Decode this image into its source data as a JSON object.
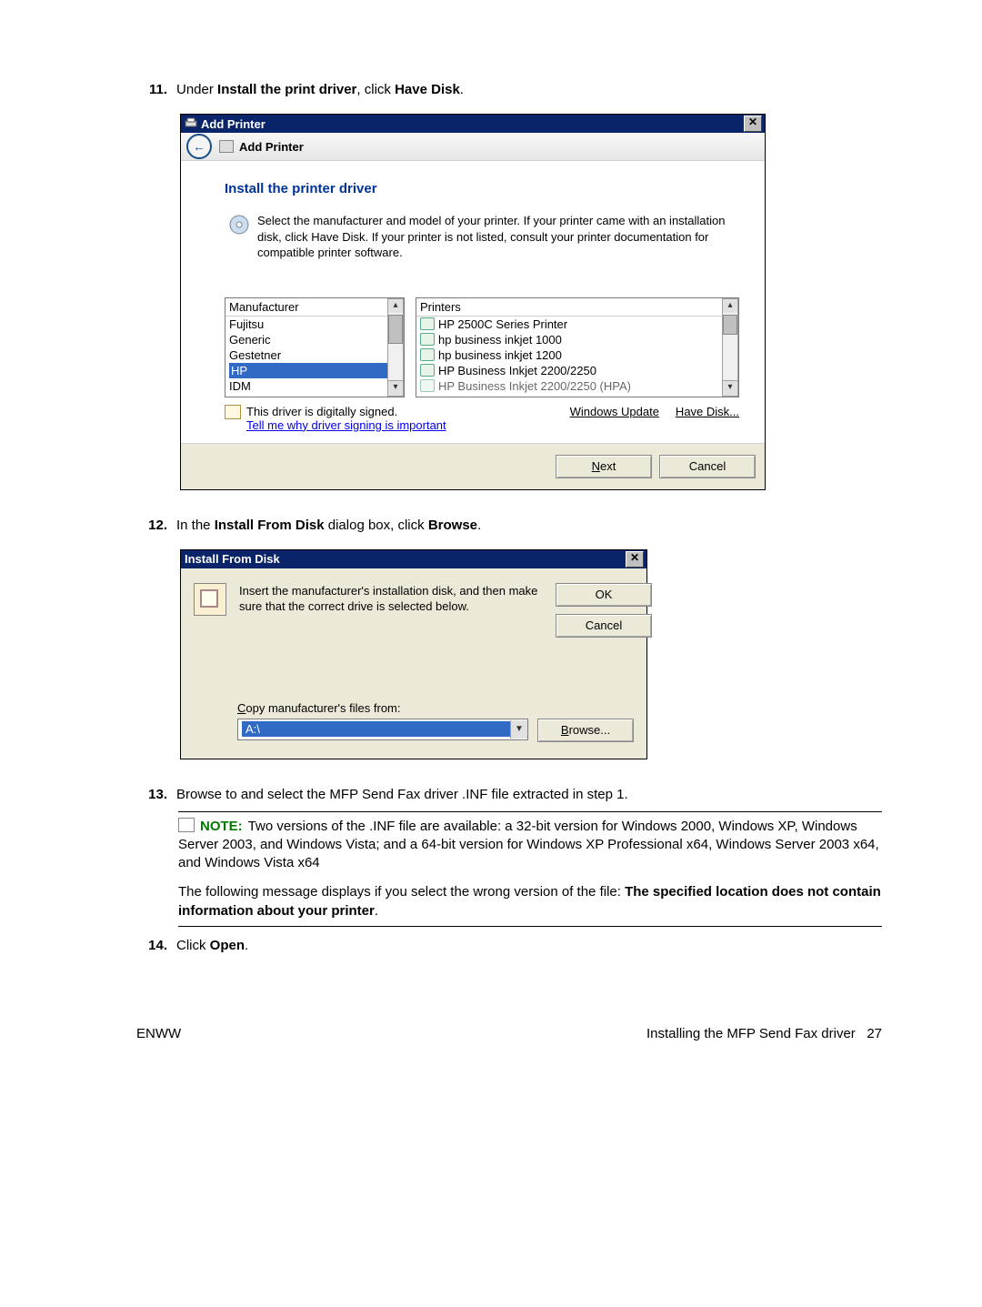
{
  "step11": {
    "num": "11.",
    "pre": "Under ",
    "b1": "Install the print driver",
    "mid": ", click ",
    "b2": "Have Disk",
    "post": "."
  },
  "addPrinter": {
    "title": "Add Printer",
    "nav": "Add Printer",
    "heading": "Install the printer driver",
    "instruction": "Select the manufacturer and model of your printer. If your printer came with an installation disk, click Have Disk. If your printer is not listed, consult your printer documentation for compatible printer software.",
    "manuHeader": "Manufacturer",
    "manufacturers": [
      "Fujitsu",
      "Generic",
      "Gestetner",
      "HP",
      "IDM"
    ],
    "selectedManuIndex": 3,
    "printerHeader": "Printers",
    "printers": [
      "HP 2500C Series Printer",
      "hp business inkjet 1000",
      "hp business inkjet 1200",
      "HP Business Inkjet 2200/2250",
      "HP Business Inkjet 2200/2250 (HPA)"
    ],
    "signed": "This driver is digitally signed.",
    "tellMe": "Tell me why driver signing is important",
    "winUpdate": "Windows Update",
    "haveDisk": "Have Disk...",
    "next": "Next",
    "cancel": "Cancel"
  },
  "step12": {
    "num": "12.",
    "pre": "In the ",
    "b1": "Install From Disk",
    "mid": " dialog box, click ",
    "b2": "Browse",
    "post": "."
  },
  "ifd": {
    "title": "Install From Disk",
    "text": "Insert the manufacturer's installation disk, and then make sure that the correct drive is selected below.",
    "ok": "OK",
    "cancel": "Cancel",
    "copyLabel": "Copy manufacturer's files from:",
    "path": "A:\\",
    "browse": "Browse..."
  },
  "step13": {
    "num": "13.",
    "text": "Browse to and select the MFP Send Fax driver .INF file extracted in step 1."
  },
  "note": {
    "label": "NOTE:",
    "body1": "Two versions of the .INF file are available: a 32-bit version for Windows 2000, Windows XP, Windows Server 2003, and Windows Vista; and a 64-bit version for Windows XP Professional x64, Windows Server 2003 x64, and Windows Vista x64",
    "body2a": "The following message displays if you select the wrong version of the file: ",
    "body2b": "The specified location does not contain information about your printer",
    "body2c": "."
  },
  "step14": {
    "num": "14.",
    "pre": "Click ",
    "b1": "Open",
    "post": "."
  },
  "footer": {
    "left": "ENWW",
    "rightText": "Installing the MFP Send Fax driver",
    "pageNum": "27"
  }
}
